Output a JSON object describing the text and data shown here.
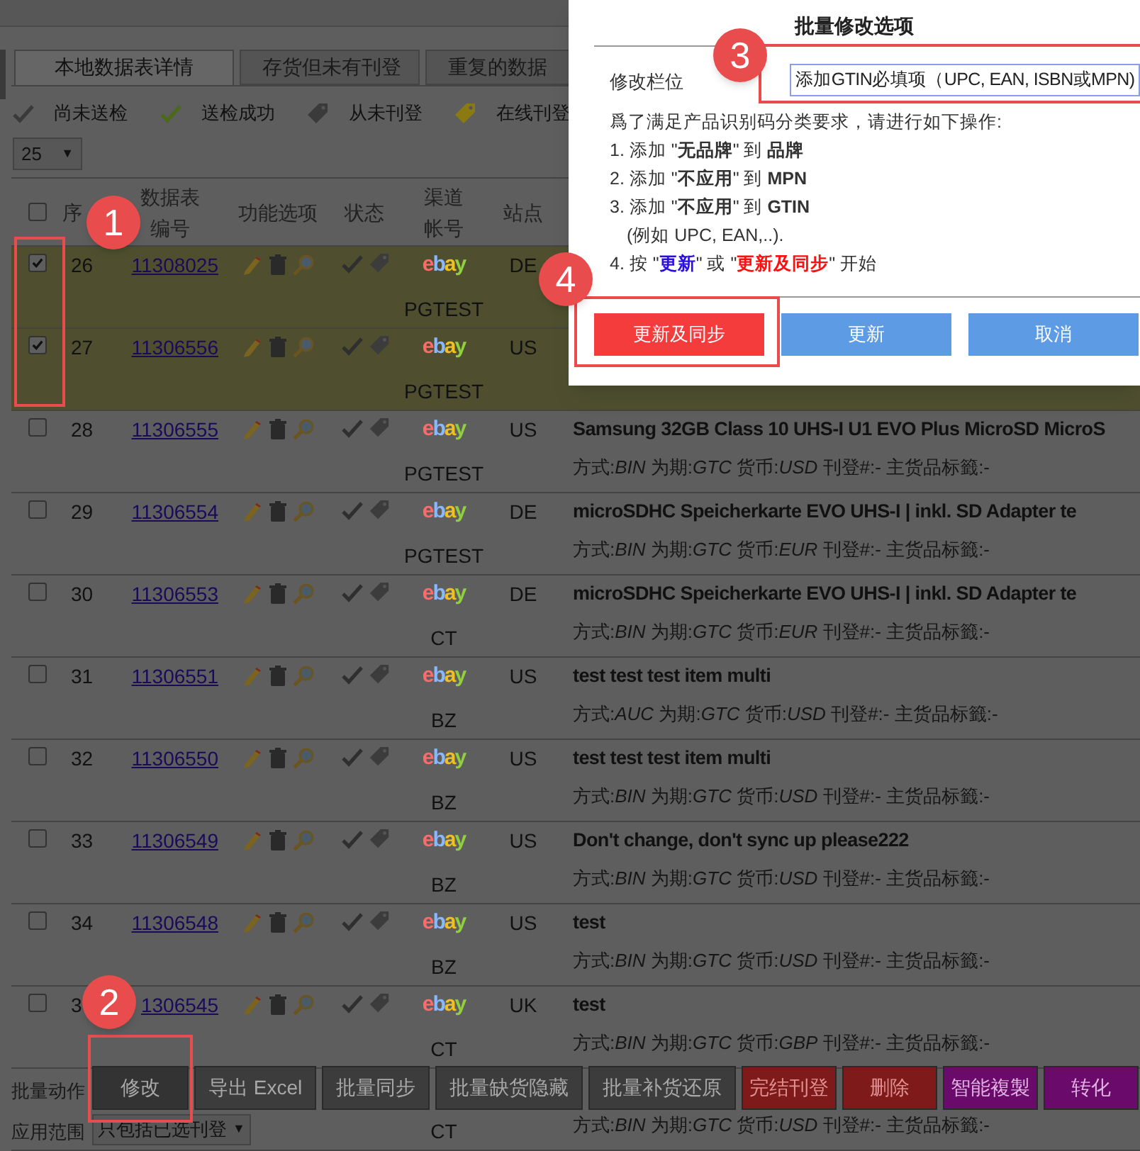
{
  "tabs": [
    {
      "label": "本地数据表详情",
      "selected": true
    },
    {
      "label": "存货但未有刊登",
      "selected": false
    },
    {
      "label": "重复的数据",
      "selected": false
    }
  ],
  "legend": [
    {
      "kind": "check",
      "color": "#3a3a3a",
      "label": "尚未送检"
    },
    {
      "kind": "check",
      "color": "#4a6a1a",
      "label": "送检成功"
    },
    {
      "kind": "tag",
      "color": "#3a3a3a",
      "label": "从未刊登"
    },
    {
      "kind": "tag",
      "color": "#8a7a10",
      "label": "在线刊登"
    }
  ],
  "page_size": {
    "value": "25",
    "arrow": "▼"
  },
  "table": {
    "select_all": {
      "checked": false
    },
    "columns": [
      "序",
      "数据表编号",
      "功能选项",
      "状态",
      "渠道帐号",
      "站点"
    ],
    "rows": [
      {
        "checked": true,
        "seq": "26",
        "id": "11308025",
        "channel": "ebay",
        "account": "PGTEST",
        "site": "DE"
      },
      {
        "checked": true,
        "seq": "27",
        "id": "11306556",
        "channel": "ebay",
        "account": "PGTEST",
        "site": "US"
      },
      {
        "checked": false,
        "seq": "28",
        "id": "11306555",
        "channel": "ebay",
        "account": "PGTEST",
        "site": "US",
        "title": "Samsung 32GB Class 10 UHS-I U1 EVO Plus MicroSD MicroS",
        "details": "方式:*BIN* 为期:*GTC* 货币:*USD* 刊登#:- 主货品标籤:-"
      },
      {
        "checked": false,
        "seq": "29",
        "id": "11306554",
        "channel": "ebay",
        "account": "PGTEST",
        "site": "DE",
        "title": "microSDHC Speicherkarte EVO UHS-I | inkl. SD Adapter te",
        "details": "方式:*BIN* 为期:*GTC* 货币:*EUR* 刊登#:- 主货品标籤:-"
      },
      {
        "checked": false,
        "seq": "30",
        "id": "11306553",
        "channel": "ebay",
        "account": "CT",
        "site": "DE",
        "title": "microSDHC Speicherkarte EVO UHS-I | inkl. SD Adapter te",
        "details": "方式:*BIN* 为期:*GTC* 货币:*EUR* 刊登#:- 主货品标籤:-"
      },
      {
        "checked": false,
        "seq": "31",
        "id": "11306551",
        "channel": "ebay",
        "account": "BZ",
        "site": "US",
        "title": "test test test item multi",
        "details": "方式:*AUC* 为期:*GTC* 货币:*USD* 刊登#:- 主货品标籤:-"
      },
      {
        "checked": false,
        "seq": "32",
        "id": "11306550",
        "channel": "ebay",
        "account": "BZ",
        "site": "US",
        "title": "test test test item multi",
        "details": "方式:*BIN* 为期:*GTC* 货币:*USD* 刊登#:- 主货品标籤:-"
      },
      {
        "checked": false,
        "seq": "33",
        "id": "11306549",
        "channel": "ebay",
        "account": "BZ",
        "site": "US",
        "title": "Don't change, don't sync up please222",
        "details": "方式:*BIN* 为期:*GTC* 货币:*USD* 刊登#:- 主货品标籤:-"
      },
      {
        "checked": false,
        "seq": "34",
        "id": "11306548",
        "channel": "ebay",
        "account": "BZ",
        "site": "US",
        "title": "test",
        "details": "方式:*BIN* 为期:*GTC* 货币:*USD* 刊登#:- 主货品标籤:-"
      },
      {
        "checked": false,
        "seq": "3",
        "id": "1306545",
        "channel": "ebay",
        "account": "CT",
        "site": "UK",
        "title": "test",
        "details": "方式:*BIN* 为期:*GTC* 货币:*GBP* 刊登#:- 主货品标籤:-"
      },
      {
        "account": "CT",
        "details": "方式:*BIN* 为期:*GTC* 货币:*USD* 刊登#:- 主货品标籤:-"
      }
    ]
  },
  "dialog": {
    "title": "批量修改选项",
    "field_label": "修改栏位",
    "field_value": "添加GTIN必填项（UPC, EAN, ISBN或MPN)",
    "instructions": [
      "爲了满足产品识别码分类要求，请进行如下操作:",
      "1. 添加 \"**无品牌**\" 到 **品牌**",
      "2. 添加 \"**不应用**\" 到 **MPN**",
      "3. 添加 \"**不应用**\" 到 **GTIN**",
      "(例如 UPC, EAN,..)."
    ],
    "final_step": [
      {
        "kind": "plain",
        "text": "4. 按 \""
      },
      {
        "kind": "update",
        "text": "更新"
      },
      {
        "kind": "plain",
        "text": "\" 或 \""
      },
      {
        "kind": "sync",
        "text": "更新及同步"
      },
      {
        "kind": "plain",
        "text": "\" 开始"
      }
    ],
    "buttons": [
      {
        "kind": "sync",
        "label": "更新及同步"
      },
      {
        "kind": "update",
        "label": "更新"
      },
      {
        "kind": "cancel",
        "label": "取消"
      }
    ]
  },
  "bulk_actions": {
    "label": "批量动作",
    "buttons": [
      {
        "kind": "dark",
        "label": "修改"
      },
      {
        "kind": "gray",
        "label": "导出 Excel"
      },
      {
        "kind": "gray",
        "label": "批量同步"
      },
      {
        "kind": "gray",
        "label": "批量缺货隐藏"
      },
      {
        "kind": "gray",
        "label": "批量补货还原"
      },
      {
        "kind": "red",
        "label": "完结刊登"
      },
      {
        "kind": "red",
        "label": "删除"
      },
      {
        "kind": "purple",
        "label": "智能複製"
      },
      {
        "kind": "purple",
        "label": "转化"
      }
    ],
    "scope_label": "应用范围",
    "scope": {
      "value": "只包括已选刊登",
      "arrow": "▼"
    }
  },
  "annotations": [
    {
      "label": "1"
    },
    {
      "label": "2"
    },
    {
      "label": "3"
    },
    {
      "label": "4"
    }
  ]
}
